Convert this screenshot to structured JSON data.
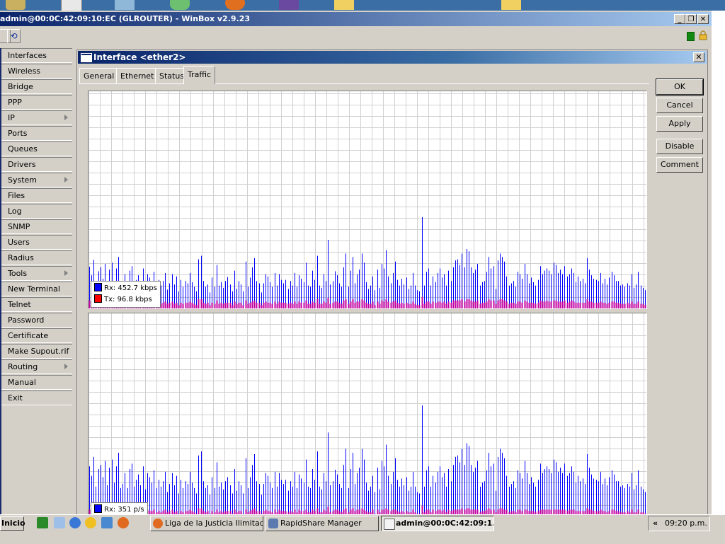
{
  "window": {
    "title": "admin@00:0C:42:09:10:EC (GLROUTER) - WinBox v2.9.23",
    "min_label": "_",
    "restore_label": "❐",
    "close_label": "✕"
  },
  "sidebar": {
    "items": [
      {
        "label": "Interfaces",
        "submenu": false
      },
      {
        "label": "Wireless",
        "submenu": false
      },
      {
        "label": "Bridge",
        "submenu": false
      },
      {
        "label": "PPP",
        "submenu": false
      },
      {
        "label": "IP",
        "submenu": true
      },
      {
        "label": "Ports",
        "submenu": false
      },
      {
        "label": "Queues",
        "submenu": false
      },
      {
        "label": "Drivers",
        "submenu": false
      },
      {
        "label": "System",
        "submenu": true
      },
      {
        "label": "Files",
        "submenu": false
      },
      {
        "label": "Log",
        "submenu": false
      },
      {
        "label": "SNMP",
        "submenu": false
      },
      {
        "label": "Users",
        "submenu": false
      },
      {
        "label": "Radius",
        "submenu": false
      },
      {
        "label": "Tools",
        "submenu": true
      },
      {
        "label": "New Terminal",
        "submenu": false
      },
      {
        "label": "Telnet",
        "submenu": false
      },
      {
        "label": "Password",
        "submenu": false
      },
      {
        "label": "Certificate",
        "submenu": false
      },
      {
        "label": "Make Supout.rif",
        "submenu": false
      },
      {
        "label": "Routing",
        "submenu": true
      },
      {
        "label": "Manual",
        "submenu": false
      },
      {
        "label": "Exit",
        "submenu": false
      }
    ]
  },
  "dialog": {
    "title": "Interface <ether2>",
    "close_label": "✕",
    "tabs": [
      {
        "label": "General",
        "active": false
      },
      {
        "label": "Ethernet",
        "active": false
      },
      {
        "label": "Status",
        "active": false
      },
      {
        "label": "Traffic",
        "active": true
      }
    ],
    "buttons": {
      "ok": "OK",
      "cancel": "Cancel",
      "apply": "Apply",
      "disable": "Disable",
      "comment": "Comment"
    }
  },
  "traffic": {
    "rx_color": "#0000ff",
    "tx_color": "#ff0000",
    "bits_legend": {
      "rx": "Rx: 452.7 kbps",
      "tx": "Tx: 96.8 kbps"
    },
    "packets_legend": {
      "rx": "Rx: 351 p/s"
    }
  },
  "chart_data": [
    {
      "type": "bar",
      "title": "",
      "grid": true,
      "legend_placement": "bottom-left",
      "series": [
        {
          "name": "Rx: 452.7 kbps",
          "color": "#0000ff",
          "values": [
            73,
            58,
            85,
            40,
            65,
            72,
            52,
            78,
            40,
            68,
            80,
            45,
            70,
            90,
            38,
            44,
            60,
            38,
            66,
            74,
            40,
            50,
            58,
            42,
            70,
            36,
            60,
            54,
            47,
            64,
            38,
            50,
            40,
            48,
            62,
            33,
            44,
            60,
            42,
            56,
            30,
            50,
            38,
            48,
            44,
            62,
            46,
            38,
            30,
            86,
            92,
            48,
            38,
            42,
            28,
            54,
            38,
            76,
            40,
            46,
            36,
            48,
            55,
            42,
            30,
            66,
            34,
            48,
            42,
            30,
            82,
            38,
            54,
            72,
            88,
            48,
            44,
            28,
            44,
            60,
            56,
            46,
            38,
            62,
            40,
            60,
            50,
            44,
            50,
            34,
            48,
            40,
            62,
            38,
            58,
            52,
            46,
            80,
            40,
            38,
            66,
            50,
            92,
            40,
            36,
            60,
            48,
            120,
            42,
            48,
            65,
            58,
            44,
            38,
            72,
            96,
            38,
            66,
            90,
            44,
            60,
            68,
            96,
            80,
            46,
            34,
            40,
            56,
            32,
            68,
            36,
            78,
            70,
            102,
            56,
            44,
            62,
            82,
            50,
            40,
            52,
            42,
            54,
            34,
            40,
            62,
            40,
            32,
            30,
            160,
            40,
            64,
            70,
            40,
            56,
            46,
            62,
            70,
            54,
            60,
            40,
            66,
            48,
            72,
            84,
            86,
            76,
            96,
            72,
            104,
            100,
            72,
            62,
            68,
            78,
            40,
            46,
            48,
            64,
            90,
            70,
            74,
            34,
            84,
            96,
            90,
            82,
            56,
            40,
            44,
            48,
            38,
            64,
            60,
            52,
            78,
            60,
            44,
            54,
            46,
            40,
            50,
            74,
            60,
            66,
            70,
            66,
            60,
            80,
            76,
            62,
            68,
            60,
            74,
            56,
            60,
            70,
            62,
            46,
            56,
            48,
            52,
            44,
            88,
            68,
            58,
            52,
            50,
            48,
            62,
            44,
            52,
            42,
            54,
            64,
            58,
            48,
            48,
            40,
            42,
            38,
            44,
            40,
            60,
            36,
            42,
            64,
            40,
            36,
            32
          ]
        },
        {
          "name": "Tx: 96.8 kbps",
          "color": "#ff0000",
          "values": [
            14,
            10,
            16,
            8,
            12,
            14,
            10,
            16,
            8,
            12,
            16,
            8,
            14,
            16,
            8,
            10,
            12,
            8,
            12,
            14,
            8,
            10,
            12,
            8,
            14,
            8,
            12,
            10,
            10,
            12,
            8,
            10,
            8,
            10,
            12,
            8,
            10,
            12,
            8,
            10,
            6,
            10,
            8,
            10,
            10,
            12,
            10,
            8,
            6,
            16,
            16,
            10,
            8,
            10,
            6,
            10,
            8,
            14,
            8,
            10,
            8,
            10,
            10,
            10,
            6,
            12,
            8,
            10,
            10,
            6,
            14,
            8,
            10,
            12,
            14,
            10,
            10,
            6,
            10,
            12,
            10,
            10,
            8,
            12,
            8,
            12,
            10,
            10,
            10,
            8,
            10,
            8,
            12,
            8,
            12,
            10,
            10,
            14,
            8,
            8,
            12,
            10,
            16,
            8,
            8,
            12,
            10,
            18,
            8,
            10,
            12,
            12,
            10,
            8,
            14,
            16,
            8,
            12,
            16,
            10,
            12,
            12,
            16,
            14,
            10,
            8,
            8,
            12,
            6,
            12,
            8,
            14,
            12,
            16,
            12,
            10,
            12,
            14,
            10,
            8,
            10,
            8,
            10,
            8,
            8,
            12,
            8,
            6,
            6,
            20,
            8,
            12,
            12,
            8,
            12,
            10,
            12,
            12,
            10,
            12,
            8,
            12,
            10,
            14,
            14,
            14,
            14,
            16,
            12,
            16,
            16,
            14,
            12,
            12,
            14,
            8,
            10,
            10,
            12,
            16,
            14,
            14,
            8,
            14,
            16,
            16,
            14,
            12,
            8,
            10,
            10,
            8,
            12,
            12,
            10,
            14,
            12,
            10,
            10,
            10,
            8,
            10,
            14,
            12,
            12,
            14,
            12,
            12,
            14,
            14,
            12,
            12,
            12,
            14,
            10,
            12,
            14,
            12,
            10,
            10,
            10,
            10,
            10,
            16,
            12,
            12,
            10,
            10,
            10,
            12,
            10,
            10,
            8,
            10,
            12,
            12,
            10,
            10,
            8,
            8,
            8,
            10,
            8,
            12,
            8,
            8,
            12,
            8,
            8,
            6
          ]
        }
      ]
    },
    {
      "type": "bar",
      "title": "",
      "grid": true,
      "legend_placement": "bottom-left",
      "series": [
        {
          "name": "Rx: 351 p/s",
          "color": "#0000ff",
          "values": [
            74,
            60,
            88,
            44,
            70,
            76,
            58,
            82,
            46,
            72,
            84,
            50,
            74,
            94,
            42,
            48,
            64,
            42,
            70,
            78,
            44,
            54,
            62,
            46,
            74,
            40,
            64,
            58,
            50,
            68,
            42,
            54,
            44,
            52,
            66,
            36,
            48,
            64,
            46,
            60,
            34,
            54,
            42,
            52,
            48,
            66,
            50,
            42,
            34,
            90,
            96,
            52,
            42,
            46,
            32,
            58,
            42,
            80,
            44,
            50,
            40,
            52,
            58,
            46,
            34,
            70,
            38,
            52,
            46,
            34,
            86,
            42,
            58,
            76,
            92,
            52,
            48,
            32,
            48,
            64,
            60,
            50,
            42,
            66,
            44,
            64,
            54,
            48,
            54,
            38,
            52,
            44,
            66,
            42,
            62,
            56,
            50,
            84,
            44,
            42,
            70,
            54,
            96,
            44,
            40,
            64,
            52,
            124,
            46,
            52,
            69,
            62,
            48,
            42,
            76,
            100,
            42,
            70,
            94,
            48,
            64,
            72,
            100,
            84,
            50,
            38,
            44,
            60,
            36,
            72,
            40,
            82,
            74,
            106,
            60,
            48,
            66,
            86,
            54,
            44,
            56,
            46,
            58,
            38,
            44,
            66,
            44,
            36,
            34,
            164,
            44,
            68,
            74,
            44,
            60,
            50,
            66,
            74,
            58,
            64,
            44,
            70,
            52,
            76,
            88,
            90,
            80,
            100,
            76,
            108,
            104,
            76,
            66,
            72,
            82,
            44,
            50,
            52,
            68,
            94,
            74,
            78,
            38,
            88,
            100,
            94,
            86,
            60,
            44,
            48,
            52,
            42,
            68,
            64,
            56,
            82,
            64,
            48,
            58,
            50,
            44,
            54,
            78,
            64,
            70,
            74,
            70,
            64,
            84,
            80,
            66,
            72,
            64,
            78,
            60,
            64,
            74,
            66,
            50,
            60,
            52,
            56,
            48,
            92,
            72,
            62,
            56,
            54,
            52,
            66,
            48,
            56,
            46,
            58,
            68,
            62,
            52,
            52,
            44,
            46,
            42,
            48,
            44,
            64,
            40,
            46,
            68,
            44,
            40,
            36
          ]
        },
        {
          "name": "",
          "color": "#ff0000",
          "values": [
            10,
            8,
            12,
            6,
            10,
            10,
            8,
            12,
            6,
            10,
            12,
            6,
            10,
            12,
            6,
            8,
            10,
            6,
            10,
            10,
            6,
            8,
            10,
            6,
            10,
            6,
            10,
            8,
            8,
            10,
            6,
            8,
            6,
            8,
            10,
            6,
            8,
            10,
            6,
            8,
            4,
            8,
            6,
            8,
            8,
            10,
            8,
            6,
            4,
            12,
            12,
            8,
            6,
            8,
            4,
            8,
            6,
            10,
            6,
            8,
            6,
            8,
            8,
            8,
            4,
            10,
            6,
            8,
            8,
            4,
            10,
            6,
            8,
            10,
            12,
            8,
            8,
            4,
            8,
            10,
            8,
            8,
            6,
            10,
            6,
            10,
            8,
            8,
            8,
            6,
            8,
            6,
            10,
            6,
            10,
            8,
            8,
            10,
            6,
            6,
            10,
            8,
            12,
            6,
            6,
            10,
            8,
            14,
            6,
            8,
            10,
            10,
            8,
            6,
            10,
            12,
            6,
            10,
            12,
            8,
            10,
            10,
            12,
            10,
            8,
            6,
            6,
            10,
            4,
            10,
            6,
            10,
            10,
            12,
            10,
            8,
            10,
            10,
            8,
            6,
            8,
            6,
            8,
            6,
            6,
            10,
            6,
            4,
            4,
            16,
            6,
            10,
            10,
            6,
            10,
            8,
            10,
            10,
            8,
            10,
            6,
            10,
            8,
            10,
            10,
            10,
            10,
            12,
            10,
            12,
            12,
            10,
            10,
            10,
            10,
            6,
            8,
            8,
            10,
            12,
            10,
            10,
            6,
            10,
            12,
            12,
            10,
            10,
            6,
            8,
            8,
            6,
            10,
            10,
            8,
            10,
            10,
            8,
            8,
            8,
            6,
            8,
            10,
            10,
            10,
            10,
            10,
            10,
            10,
            10,
            10,
            10,
            10,
            10,
            8,
            10,
            10,
            10,
            8,
            8,
            8,
            8,
            8,
            12,
            10,
            10,
            8,
            8,
            8,
            10,
            8,
            8,
            6,
            8,
            10,
            10,
            8,
            8,
            6,
            6,
            6,
            8,
            6,
            10,
            6,
            6,
            10,
            6,
            6,
            4
          ]
        }
      ]
    }
  ],
  "taskbar": {
    "start_label": "Inicio",
    "tasks": [
      {
        "label": "Liga de la Justicia Ilimitad...",
        "active": false
      },
      {
        "label": "RapidShare Manager",
        "active": false
      },
      {
        "label": "admin@00:0C:42:09:1...",
        "active": true
      }
    ],
    "tray_chevron": "«",
    "clock": "09:20 p.m."
  }
}
